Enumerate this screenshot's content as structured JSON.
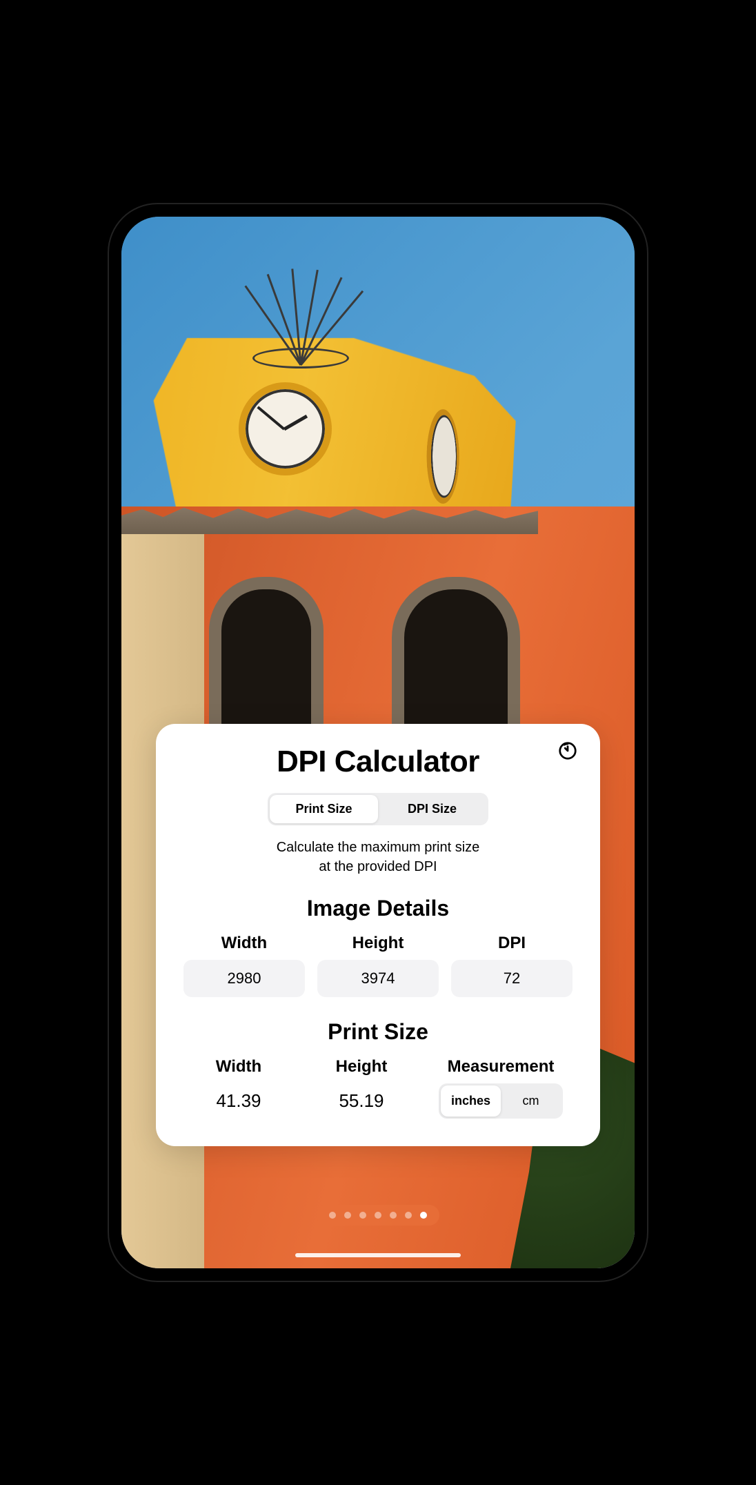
{
  "card": {
    "title": "DPI Calculator",
    "tabs": {
      "print_size": "Print Size",
      "dpi_size": "DPI Size"
    },
    "description_line1": "Calculate the maximum print size",
    "description_line2": "at the provided DPI",
    "image_details": {
      "title": "Image Details",
      "width_label": "Width",
      "width_value": "2980",
      "height_label": "Height",
      "height_value": "3974",
      "dpi_label": "DPI",
      "dpi_value": "72"
    },
    "print_size": {
      "title": "Print Size",
      "width_label": "Width",
      "width_value": "41.39",
      "height_label": "Height",
      "height_value": "55.19",
      "measurement_label": "Measurement",
      "units": {
        "inches": "inches",
        "cm": "cm"
      }
    }
  },
  "pagination": {
    "total": 7,
    "active_index": 6
  }
}
